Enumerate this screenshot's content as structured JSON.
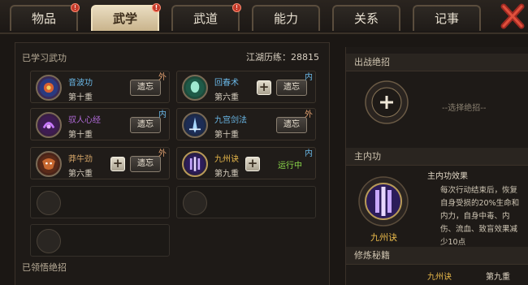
{
  "tabs": [
    {
      "label": "物品",
      "badge": "!"
    },
    {
      "label": "武学",
      "badge": "!"
    },
    {
      "label": "武道",
      "badge": "!"
    },
    {
      "label": "能力",
      "badge": ""
    },
    {
      "label": "关系",
      "badge": ""
    },
    {
      "label": "记事",
      "badge": ""
    }
  ],
  "left": {
    "learned_title": "已学习武功",
    "exp_label": "江湖历练：",
    "exp_value": "28815",
    "forget_label": "遗忘",
    "running_label": "运行中",
    "skills": [
      {
        "name": "音波功",
        "level": "第十重",
        "tag": "外",
        "name_color": "#6ab8e8"
      },
      {
        "name": "回春术",
        "level": "第六重",
        "tag": "内",
        "name_color": "#6ab8e8"
      },
      {
        "name": "驭人心经",
        "level": "第十重",
        "tag": "内",
        "name_color": "#b06ad8"
      },
      {
        "name": "九宫剑法",
        "level": "第十重",
        "tag": "外",
        "name_color": "#6ab8e8"
      },
      {
        "name": "莽牛劲",
        "level": "第六重",
        "tag": "外",
        "name_color": "#d8a86a"
      },
      {
        "name": "九州诀",
        "level": "第九重",
        "tag": "内",
        "name_color": "#e8b84a"
      }
    ],
    "ultimate_title": "已领悟绝招"
  },
  "right": {
    "battle_title": "出战绝招",
    "select_placeholder": "--选择绝招--",
    "main_inner_title": "主内功",
    "effect_title": "主内功效果",
    "effect_text_1": "每次行动结束后，恢复",
    "effect_text_2": "自身受损的20%生命和",
    "effect_text_3": "内力，自身中毒、内",
    "effect_text_4": "伤、流血、致盲效果减",
    "effect_text_5": "少10点",
    "main_skill_name": "九州诀",
    "training_title": "修炼秘籍",
    "training_skill": "九州诀",
    "training_level": "第九重"
  },
  "colors": {
    "accent_gold": "#e8b84a",
    "exp_blue": "#6ab8e8",
    "running_green": "#8bd84a"
  }
}
